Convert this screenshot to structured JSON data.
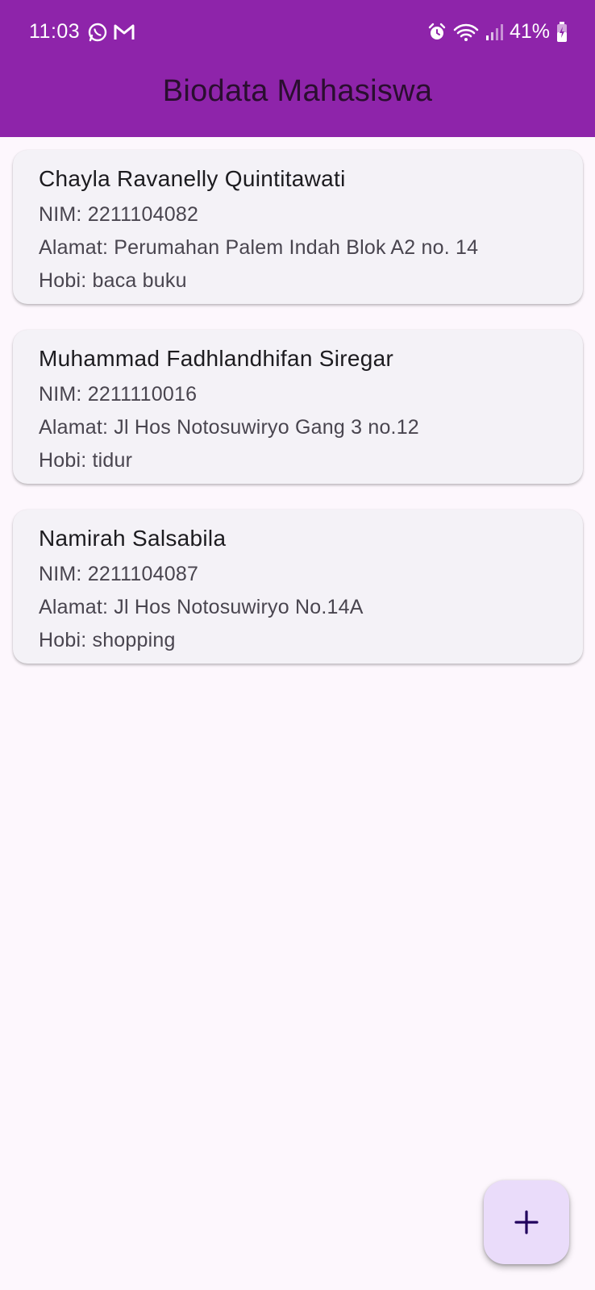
{
  "status_bar": {
    "time": "11:03",
    "battery": "41%",
    "icons": [
      "whatsapp-icon",
      "gmail-icon",
      "alarm-icon",
      "wifi-icon",
      "signal-icon",
      "battery-charging-icon"
    ]
  },
  "app_bar": {
    "title": "Biodata Mahasiswa",
    "color": "#8e24aa"
  },
  "students": [
    {
      "name": "Chayla Ravanelly Quintitawati",
      "nim": "NIM: 2211104082",
      "alamat": "Alamat: Perumahan Palem Indah Blok A2 no. 14",
      "hobi": "Hobi: baca buku"
    },
    {
      "name": "Muhammad Fadhlandhifan Siregar",
      "nim": "NIM: 2211110016",
      "alamat": "Alamat: Jl Hos Notosuwiryo Gang 3 no.12",
      "hobi": "Hobi: tidur"
    },
    {
      "name": "Namirah Salsabila",
      "nim": "NIM: 2211104087",
      "alamat": "Alamat: Jl Hos Notosuwiryo No.14A",
      "hobi": "Hobi: shopping"
    }
  ],
  "fab": {
    "icon": "plus-icon",
    "color": "#eadcfa"
  }
}
